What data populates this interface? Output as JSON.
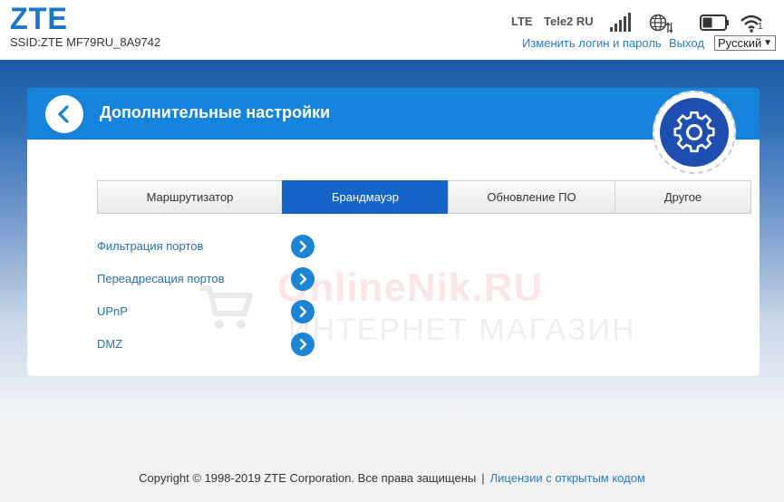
{
  "header": {
    "logo": "ZTE",
    "ssid": "SSID:ZTE MF79RU_8A9742",
    "network_type": "LTE",
    "operator": "Tele2 RU",
    "change_login_link": "Изменить логин и пароль",
    "logout_link": "Выход",
    "language": "Русский",
    "wifi_clients": "1",
    "icons": [
      "signal-bars-icon",
      "globe-data-icon",
      "battery-icon",
      "wifi-icon"
    ]
  },
  "page": {
    "title": "Дополнительные настройки",
    "tabs": [
      {
        "label": "Маршрутизатор",
        "active": false
      },
      {
        "label": "Брандмауэр",
        "active": true
      },
      {
        "label": "Обновление ПО",
        "active": false
      },
      {
        "label": "Другое",
        "active": false
      }
    ],
    "menu": [
      {
        "label": "Фильтрация портов"
      },
      {
        "label": "Переадресация портов"
      },
      {
        "label": "UPnP"
      },
      {
        "label": "DMZ"
      }
    ]
  },
  "watermark": {
    "brand": "OnlineNik.RU",
    "tagline": "ИНТЕРНЕТ МАГАЗИН"
  },
  "footer": {
    "copyright": "Copyright © 1998-2019 ZTE Corporation. Все права защищены",
    "separator": "|",
    "license_link": "Лицензии с открытым кодом"
  },
  "colors": {
    "accent": "#1583d9",
    "active_tab": "#1565c8",
    "link": "#2a7bc0",
    "header_band": "#1b5ba8"
  }
}
